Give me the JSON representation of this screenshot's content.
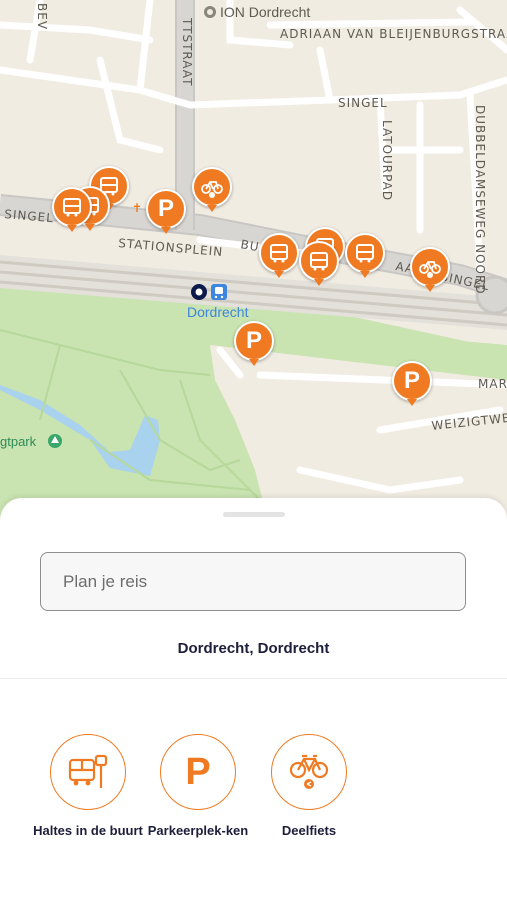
{
  "map": {
    "poi_label": "ION Dordrecht",
    "station_label": "Dordrecht",
    "park_label": "gtpark",
    "streets": {
      "adriaan": "ADRIAAN VAN BLEIJENBURGSTRAAT",
      "singel_top": "SINGEL",
      "singel_left": "SINGEL",
      "singel_right": "SINGEL",
      "stationsplein": "STATIONSPLEIN",
      "bu": "BU",
      "aal": "AAL",
      "latourpad": "LATOURPAD",
      "dubbeldamseweg": "DUBBELDAMSEWEG NOORD",
      "weizigtweg": "WEIZIGTWEG",
      "mark": "MARK",
      "ttstraat": "TTSTRAAT",
      "bev": "BEV"
    },
    "pin_colors": {
      "orange": "#f07a22"
    },
    "parking_letter": "P"
  },
  "sheet": {
    "search_placeholder": "Plan je reis",
    "location": "Dordrecht, Dordrecht",
    "categories": [
      {
        "label": "Haltes in de buurt",
        "icon": "bus-stop-icon"
      },
      {
        "label": "Parkeerplek-ken",
        "icon": "parking-icon",
        "letter": "P"
      },
      {
        "label": "Deelfiets",
        "icon": "shared-bike-icon"
      }
    ]
  }
}
